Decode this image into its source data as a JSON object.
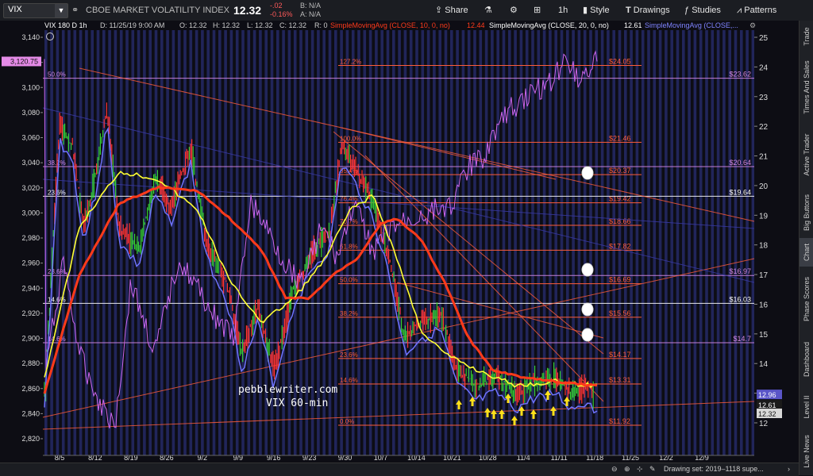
{
  "toolbar": {
    "symbol": "VIX",
    "index_name": "CBOE MARKET VOLATILITY INDEX",
    "last": "12.32",
    "change": "-.02",
    "change_pct": "-0.16%",
    "bid": "B: N/A",
    "ask": "A: N/A",
    "share": "Share",
    "interval": "1h",
    "style": "Style",
    "drawings": "Drawings",
    "studies": "Studies",
    "patterns": "Patterns"
  },
  "header_studies": {
    "symbol_desc": "VIX 180 D 1h",
    "datetime": "D: 11/25/19 9:00 AM",
    "open": "O: 12.32",
    "high": "H: 12.32",
    "low": "L: 12.32",
    "close": "C: 12.32",
    "r": "R: 0",
    "sma10": "SimpleMovingAvg (CLOSE, 10, 0, no)",
    "sma10_value": "12.44",
    "sma20": "SimpleMovingAvg (CLOSE, 20, 0, no)",
    "sma20_value": "12.61",
    "sma_third": "SimpleMovingAvg (CLOSE,..."
  },
  "watermark": {
    "line1": "pebblewriter.com",
    "line2": "VIX 60-min"
  },
  "left_axis": [
    {
      "label": "3,140",
      "value": 3140
    },
    {
      "label": "3,120",
      "value": 3120
    },
    {
      "label": "3,100",
      "value": 3100
    },
    {
      "label": "3,080",
      "value": 3080
    },
    {
      "label": "3,060",
      "value": 3060
    },
    {
      "label": "3,040",
      "value": 3040
    },
    {
      "label": "3,020",
      "value": 3020
    },
    {
      "label": "3,000",
      "value": 3000
    },
    {
      "label": "2,980",
      "value": 2980
    },
    {
      "label": "2,960",
      "value": 2960
    },
    {
      "label": "2,940",
      "value": 2940
    },
    {
      "label": "2,920",
      "value": 2920
    },
    {
      "label": "2,900",
      "value": 2900
    },
    {
      "label": "2,880",
      "value": 2880
    },
    {
      "label": "2,860",
      "value": 2860
    },
    {
      "label": "2,840",
      "value": 2840
    },
    {
      "label": "2,820",
      "value": 2820
    }
  ],
  "left_axis_badge": {
    "label": "3,120.75",
    "value": 3120.75
  },
  "right_axis": [
    {
      "label": "25",
      "value": 25
    },
    {
      "label": "24",
      "value": 24
    },
    {
      "label": "23",
      "value": 23
    },
    {
      "label": "22",
      "value": 22
    },
    {
      "label": "21",
      "value": 21
    },
    {
      "label": "20",
      "value": 20
    },
    {
      "label": "19",
      "value": 19
    },
    {
      "label": "18",
      "value": 18
    },
    {
      "label": "17",
      "value": 17
    },
    {
      "label": "16",
      "value": 16
    },
    {
      "label": "15",
      "value": 15
    },
    {
      "label": "14",
      "value": 14
    },
    {
      "label": "13",
      "value": 13
    },
    {
      "label": "12",
      "value": 12
    }
  ],
  "right_axis_badges": [
    {
      "label": "12.96",
      "value": 12.96,
      "color": "#5a55c8"
    },
    {
      "label": "12.61",
      "value": 12.61,
      "color": "#1a1a1a"
    },
    {
      "label": "12.32",
      "value": 12.32,
      "color": "#d8d8d8"
    }
  ],
  "x_axis": [
    "8/5",
    "8/12",
    "8/19",
    "8/26",
    "9/2",
    "9/9",
    "9/16",
    "9/23",
    "9/30",
    "10/7",
    "10/14",
    "10/21",
    "10/28",
    "11/4",
    "11/11",
    "11/18",
    "11/25",
    "12/2",
    "12/9"
  ],
  "vix_fib": [
    {
      "pct": "127.2%",
      "val": "$24.05",
      "value": 24.05
    },
    {
      "pct": "100.0%",
      "val": "$21.46",
      "value": 21.46
    },
    {
      "pct": "85.4%",
      "val": "$20.37",
      "value": 20.37
    },
    {
      "pct": "76.4%",
      "val": "$19.42",
      "value": 19.42
    },
    {
      "pct": "70.7%",
      "val": "$18.66",
      "value": 18.66
    },
    {
      "pct": "61.8%",
      "val": "$17.82",
      "value": 17.82
    },
    {
      "pct": "50.0%",
      "val": "$16.69",
      "value": 16.69
    },
    {
      "pct": "38.2%",
      "val": "$15.56",
      "value": 15.56
    },
    {
      "pct": "23.6%",
      "val": "$14.17",
      "value": 14.17
    },
    {
      "pct": "14.6%",
      "val": "$13.31",
      "value": 13.31
    },
    {
      "pct": "0.0%",
      "val": "$11.92",
      "value": 11.92
    }
  ],
  "spx_fib": [
    {
      "pct": "50.0%",
      "val": "$23.62",
      "value": 23.62,
      "color": "#d88be8"
    },
    {
      "pct": "38.2%",
      "val": "$20.64",
      "value": 20.64,
      "color": "#d88be8"
    },
    {
      "pct": "23.6%",
      "val": "$19.64",
      "value": 19.64,
      "color": "#ffffff"
    },
    {
      "pct": "23.6%",
      "val": "$16.97",
      "value": 16.97,
      "color": "#d88be8"
    },
    {
      "pct": "14.6%",
      "val": "$16.03",
      "value": 16.03,
      "color": "#ffffff"
    },
    {
      "pct": "14.6%",
      "val": "$14.7",
      "value": 14.7,
      "color": "#d88be8"
    }
  ],
  "bottom_bar": {
    "drawing_set": "Drawing set: 2019–1118 supe..."
  },
  "side_tabs": [
    "Trade",
    "Times And Sales",
    "Active Trader",
    "Big Buttons",
    "Chart",
    "Phase Scores",
    "Dashboard",
    "Level II",
    "Live News"
  ],
  "colors": {
    "background": "#0d0d14",
    "stripe": "#262a66",
    "vix_fib": "#ff5c3a",
    "spx_fib": "#d88be8",
    "sma10": "#ffff33",
    "sma20": "#6f73ff",
    "sma_third": "#ff3a1a",
    "spx": "#cc66ee"
  }
}
